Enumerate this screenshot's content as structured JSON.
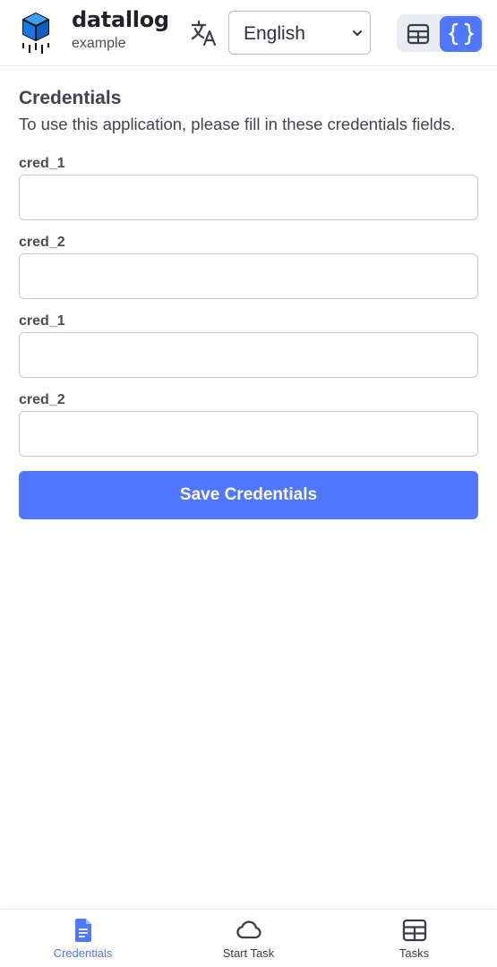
{
  "header": {
    "brand_name": "datallog",
    "brand_sub": "example",
    "language": "English",
    "icons": {
      "logo": "cube-logo-icon",
      "translate": "translate-icon",
      "table_view": "table-view-icon",
      "json_view": "braces-icon"
    }
  },
  "main": {
    "title": "Credentials",
    "description": "To use this application, please fill in these credentials fields.",
    "fields": [
      {
        "label": "cred_1",
        "value": ""
      },
      {
        "label": "cred_2",
        "value": ""
      },
      {
        "label": "cred_1",
        "value": ""
      },
      {
        "label": "cred_2",
        "value": ""
      }
    ],
    "save_label": "Save Credentials"
  },
  "bottom_nav": {
    "items": [
      {
        "label": "Credentials",
        "icon": "document-icon",
        "active": true
      },
      {
        "label": "Start Task",
        "icon": "cloud-icon",
        "active": false
      },
      {
        "label": "Tasks",
        "icon": "table-icon",
        "active": false
      }
    ]
  },
  "colors": {
    "accent": "#4f77ff",
    "text": "#3f4350",
    "border": "#c4c8d0"
  }
}
